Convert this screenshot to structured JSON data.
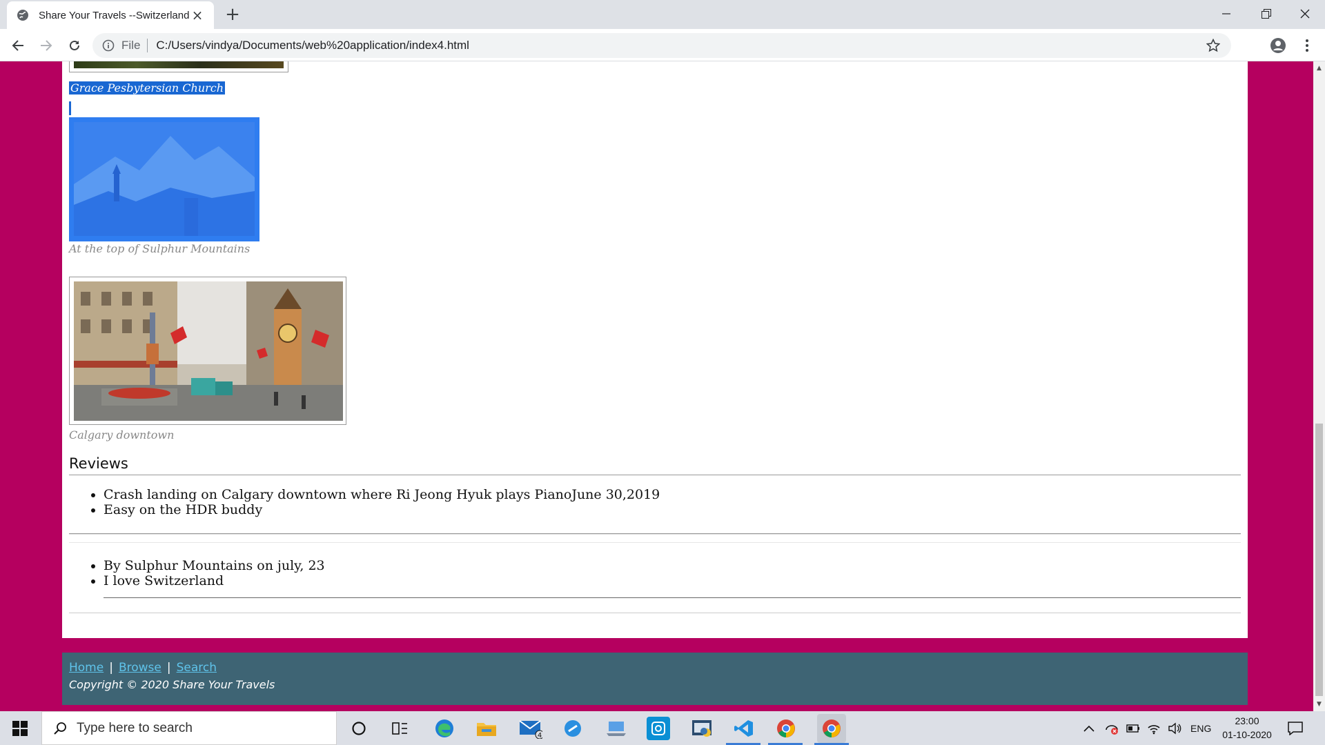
{
  "browser": {
    "tab_title": "Share Your Travels --Switzerland",
    "new_tab": "+",
    "file_label": "File",
    "url": "C:/Users/vindya/Documents/web%20application/index4.html"
  },
  "page": {
    "captions": [
      "Grace Pesbytersian Church",
      "At the top of Sulphur Mountains",
      "Calgary downtown"
    ],
    "reviews_heading": "Reviews",
    "reviews_group1": [
      "Crash landing on Calgary downtown where Ri Jeong Hyuk plays PianoJune 30,2019",
      "Easy on the HDR buddy"
    ],
    "reviews_group2": [
      "By Sulphur Mountains on july, 23",
      "I love Switzerland"
    ],
    "footer": {
      "links": [
        "Home",
        "Browse",
        "Search"
      ],
      "separator": "|",
      "copyright": "Copyright © 2020 Share Your Travels"
    }
  },
  "taskbar": {
    "search_placeholder": "Type here to search",
    "mail_badge": "4",
    "language": "ENG",
    "time": "23:00",
    "date": "01-10-2020"
  },
  "colors": {
    "page_background": "#b5005f",
    "footer_background": "#3e6474",
    "selection": "#1967d2"
  }
}
